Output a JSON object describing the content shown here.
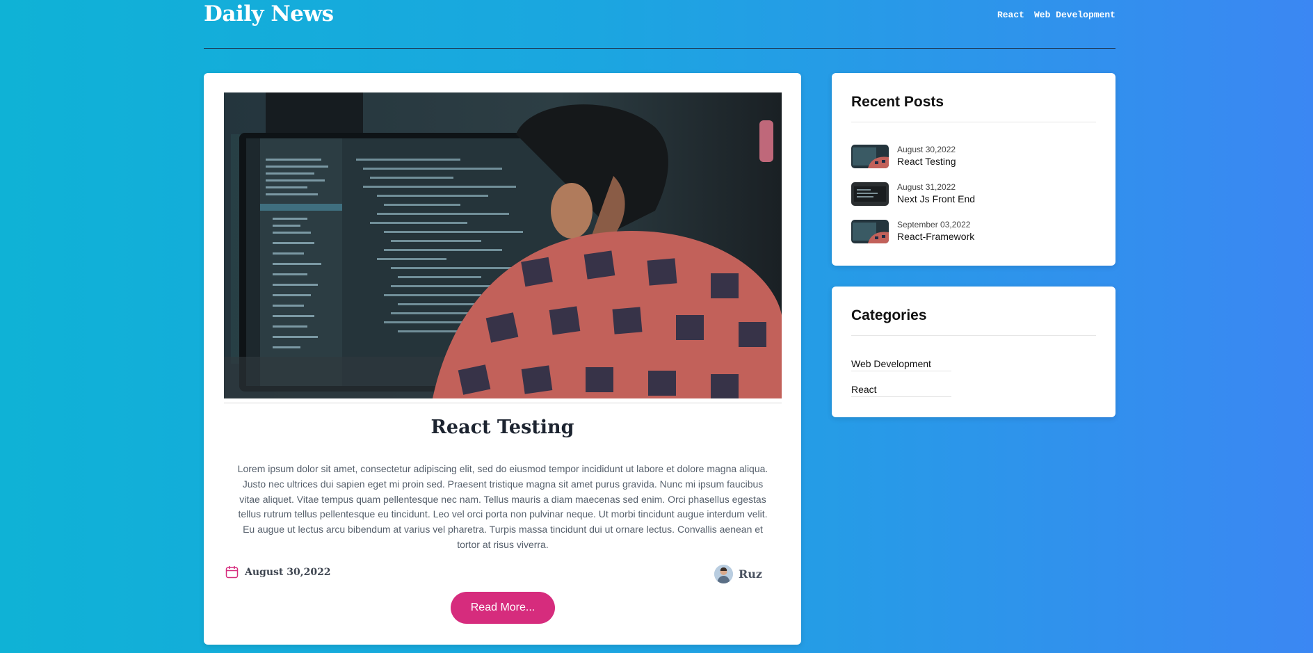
{
  "brand": "Daily News",
  "nav": [
    "React",
    "Web Development"
  ],
  "post": {
    "title": "React Testing",
    "body": "Lorem ipsum dolor sit amet, consectetur adipiscing elit, sed do eiusmod tempor incididunt ut labore et dolore magna aliqua. Justo nec ultrices dui sapien eget mi proin sed. Praesent tristique magna sit amet purus gravida. Nunc mi ipsum faucibus vitae aliquet. Vitae tempus quam pellentesque nec nam. Tellus mauris a diam maecenas sed enim. Orci phasellus egestas tellus rutrum tellus pellentesque eu tincidunt. Leo vel orci porta non pulvinar neque. Ut morbi tincidunt augue interdum velit. Eu augue ut lectus arcu bibendum at varius vel pharetra. Turpis massa tincidunt dui ut ornare lectus. Convallis aenean et tortor at risus viverra.",
    "date": "August 30,2022",
    "author": "Ruz",
    "read_more": "Read More..."
  },
  "recent": {
    "title": "Recent Posts",
    "items": [
      {
        "date": "August 30,2022",
        "title": "React Testing"
      },
      {
        "date": "August 31,2022",
        "title": "Next Js Front End"
      },
      {
        "date": "September 03,2022",
        "title": "React-Framework"
      }
    ]
  },
  "categories": {
    "title": "Categories",
    "items": [
      "Web Development",
      "React"
    ]
  },
  "colors": {
    "accent": "#d62c7d",
    "gradient_start": "#0fb2d6",
    "gradient_end": "#3b87f3"
  }
}
